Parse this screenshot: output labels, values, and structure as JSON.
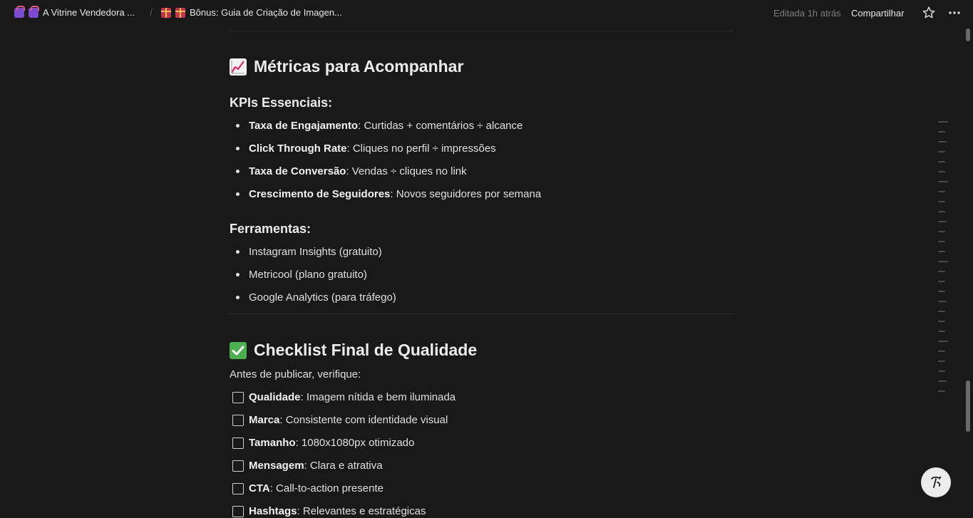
{
  "topbar": {
    "crumb1_label": "A Vitrine Vendedora ...",
    "crumb1_icon": "shopping-bags-icon",
    "separator": "/",
    "crumb2_label": "Bônus: Guia de Criação de Imagen...",
    "crumb2_icon": "gift-icon",
    "edited": "Editada 1h atrás",
    "share_label": "Compartilhar",
    "favorite_icon": "star-icon",
    "more_icon": "more-icon"
  },
  "metrics": {
    "title": "Métricas para Acompanhar",
    "title_icon": "chart-increasing-icon",
    "kpi_heading": "KPIs Essenciais:",
    "kpis": [
      {
        "bold": "Taxa de Engajamento",
        "text": ": Curtidas + comentários ÷ alcance"
      },
      {
        "bold": "Click Through Rate",
        "text": ": Cliques no perfil ÷ impressões"
      },
      {
        "bold": "Taxa de Conversão",
        "text": ": Vendas ÷ cliques no link"
      },
      {
        "bold": "Crescimento de Seguidores",
        "text": ": Novos seguidores por semana"
      }
    ],
    "tools_heading": "Ferramentas:",
    "tools": [
      "Instagram Insights (gratuito)",
      "Metricool (plano gratuito)",
      "Google Analytics (para tráfego)"
    ]
  },
  "checklist": {
    "title": "Checklist Final de Qualidade",
    "title_icon": "check-mark-button-icon",
    "intro": "Antes de publicar, verifique:",
    "items": [
      {
        "bold": "Qualidade",
        "text": ": Imagem nítida e bem iluminada",
        "checked": false
      },
      {
        "bold": "Marca",
        "text": ": Consistente com identidade visual",
        "checked": false
      },
      {
        "bold": "Tamanho",
        "text": ": 1080x1080px otimizado",
        "checked": false
      },
      {
        "bold": "Mensagem",
        "text": ": Clara e atrativa",
        "checked": false
      },
      {
        "bold": "CTA",
        "text": ": Call-to-action presente",
        "checked": false
      },
      {
        "bold": "Hashtags",
        "text": ": Relevantes e estratégicas",
        "checked": false
      }
    ]
  },
  "colors": {
    "background": "#191919",
    "text": "#e0e0e0",
    "heading": "#ececec",
    "muted": "#7d7d7d",
    "check_green": "#4caf50"
  },
  "help_icon": "help-icon"
}
